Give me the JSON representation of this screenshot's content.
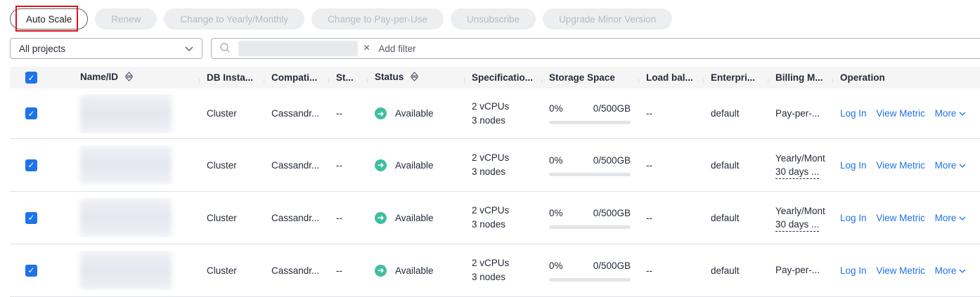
{
  "toolbar": {
    "auto_scale": "Auto Scale",
    "renew": "Renew",
    "change_yearly": "Change to Yearly/Monthly",
    "change_ppu": "Change to Pay-per-Use",
    "unsubscribe": "Unsubscribe",
    "upgrade": "Upgrade Minor Version"
  },
  "filters": {
    "project": "All projects",
    "add_filter": "Add filter"
  },
  "table": {
    "headers": [
      "Name/ID",
      "DB Insta...",
      "Compati...",
      "St...",
      "Status",
      "Specificatio...",
      "Storage Space",
      "Load bal...",
      "Enterpri...",
      "Billing M...",
      "Operation"
    ],
    "rows": [
      {
        "db_type": "Cluster",
        "compat": "Cassandr...",
        "st": "--",
        "status": "Available",
        "spec1": "2 vCPUs",
        "spec2": "3 nodes",
        "storage_pct": "0%",
        "storage_cap": "0/500GB",
        "storage_fill": 0,
        "lb": "--",
        "enterprise": "default",
        "billing1": "Pay-per-...",
        "billing2": "",
        "op1": "Log In",
        "op2": "View Metric",
        "op3": "More"
      },
      {
        "db_type": "Cluster",
        "compat": "Cassandr...",
        "st": "--",
        "status": "Available",
        "spec1": "2 vCPUs",
        "spec2": "3 nodes",
        "storage_pct": "0%",
        "storage_cap": "0/500GB",
        "storage_fill": 0,
        "lb": "--",
        "enterprise": "default",
        "billing1": "Yearly/Mont",
        "billing2": "30 days ...",
        "op1": "Log In",
        "op2": "View Metric",
        "op3": "More"
      },
      {
        "db_type": "Cluster",
        "compat": "Cassandr...",
        "st": "--",
        "status": "Available",
        "spec1": "2 vCPUs",
        "spec2": "3 nodes",
        "storage_pct": "0%",
        "storage_cap": "0/500GB",
        "storage_fill": 0,
        "lb": "--",
        "enterprise": "default",
        "billing1": "Yearly/Mont",
        "billing2": "30 days ...",
        "op1": "Log In",
        "op2": "View Metric",
        "op3": "More"
      },
      {
        "db_type": "Cluster",
        "compat": "Cassandr...",
        "st": "--",
        "status": "Available",
        "spec1": "2 vCPUs",
        "spec2": "3 nodes",
        "storage_pct": "0%",
        "storage_cap": "0/500GB",
        "storage_fill": 0,
        "lb": "--",
        "enterprise": "default",
        "billing1": "Pay-per-...",
        "billing2": "",
        "op1": "Log In",
        "op2": "View Metric",
        "op3": "More"
      }
    ]
  },
  "colors": {
    "accent": "#1e73e8",
    "status_ok": "#3fbfa0",
    "highlight": "#d9151f"
  }
}
